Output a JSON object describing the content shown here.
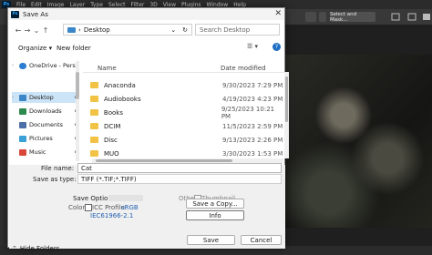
{
  "photoshop": {
    "logo": "Ps",
    "menu": [
      "File",
      "Edit",
      "Image",
      "Layer",
      "Type",
      "Select",
      "Filter",
      "3D",
      "View",
      "Plugins",
      "Window",
      "Help"
    ],
    "select_mask": "Select and Mask..."
  },
  "dialog": {
    "title": "Save As",
    "close": "✕",
    "nav": {
      "back": "←",
      "forward": "→",
      "down": "⌄",
      "up": "↑",
      "path_sep": "›",
      "path": "Desktop",
      "dropdown": "⌄",
      "refresh": "↻"
    },
    "search_placeholder": "Search Desktop",
    "organize": "Organize ▾",
    "new_folder": "New folder",
    "view": "☰ ▾",
    "help": "?",
    "sidebar": [
      {
        "label": "OneDrive - Perso",
        "color": "#2d7dd2",
        "expand": "›",
        "pinned": false
      },
      {
        "label": "Desktop",
        "color": "#3a86c8",
        "expand": "›",
        "pinned": true
      },
      {
        "label": "Downloads",
        "color": "#2d8a4e",
        "expand": "",
        "pinned": true
      },
      {
        "label": "Documents",
        "color": "#4d6fa8",
        "expand": "",
        "pinned": true
      },
      {
        "label": "Pictures",
        "color": "#3aa0d8",
        "expand": "",
        "pinned": true
      },
      {
        "label": "Music",
        "color": "#d8473a",
        "expand": "",
        "pinned": true
      }
    ],
    "pin_icon": "📌",
    "columns": {
      "name": "Name",
      "date": "Date modified"
    },
    "files": [
      {
        "name": "Anaconda",
        "date": "9/30/2023 7:29 PM"
      },
      {
        "name": "Audiobooks",
        "date": "4/19/2023 4:23 PM"
      },
      {
        "name": "Books",
        "date": "9/25/2023 10:21 PM"
      },
      {
        "name": "DCIM",
        "date": "11/5/2023 2:59 PM"
      },
      {
        "name": "Disc",
        "date": "9/13/2023 2:26 PM"
      },
      {
        "name": "MUO",
        "date": "3/30/2023 1:53 PM"
      }
    ],
    "filename_label": "File name:",
    "filename_value": "Cat",
    "savetype_label": "Save as type:",
    "savetype_value": "TIFF (*.TIF;*.TIFF)",
    "save_options": "Save Options",
    "color_label": "Color:",
    "icc_label": "ICC Profile:",
    "icc_value": "sRGB",
    "icc_value2": "IEC61966-2.1",
    "other_label": "Other:",
    "thumbnail_label": "Thumbnail",
    "save_copy": "Save a Copy...",
    "info": "Info",
    "save": "Save",
    "cancel": "Cancel",
    "hide_folders": "Hide Folders",
    "hide_chevron": "⌃"
  }
}
